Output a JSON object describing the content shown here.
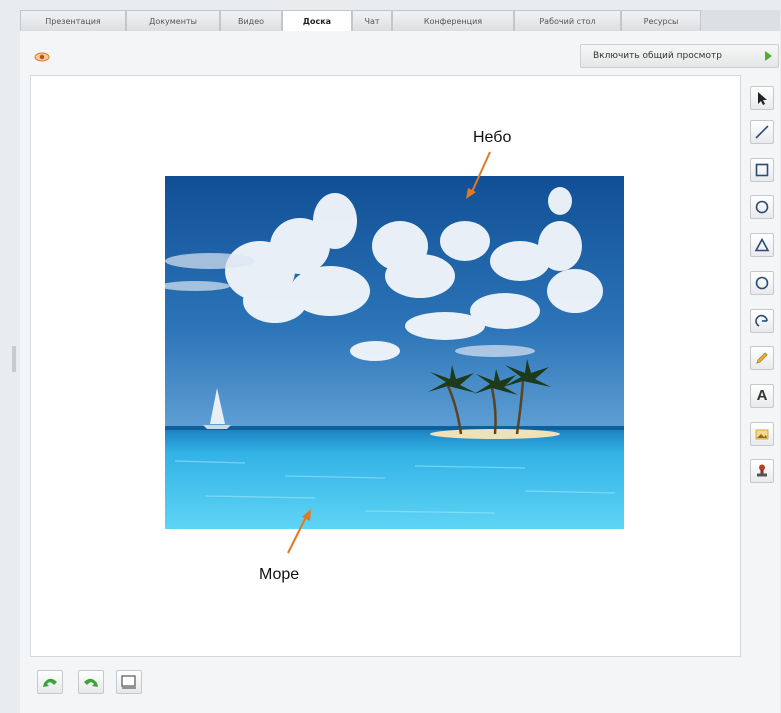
{
  "tabs": [
    {
      "label": "Презентация",
      "active": false
    },
    {
      "label": "Документы",
      "active": false
    },
    {
      "label": "Видео",
      "active": false
    },
    {
      "label": "Доска",
      "active": true
    },
    {
      "label": "Чат",
      "active": false
    },
    {
      "label": "Конференция",
      "active": false
    },
    {
      "label": "Рабочий стол",
      "active": false
    },
    {
      "label": "Ресурсы",
      "active": false
    }
  ],
  "header": {
    "share_label": "Включить общий просмотр"
  },
  "board": {
    "annotations": {
      "sky": "Небо",
      "sea": "Море"
    },
    "arrow_color": "#e07a1f"
  },
  "toolbar": {
    "tools": [
      "select-icon",
      "line-icon",
      "rectangle-icon",
      "ellipse-icon",
      "triangle-icon",
      "circle-icon",
      "rotate-icon",
      "pencil-icon",
      "text-icon",
      "insert-image-icon",
      "stamp-icon"
    ],
    "text_tool_glyph": "A"
  },
  "footer": {
    "buttons": [
      "undo-icon",
      "redo-icon",
      "clear-board-icon"
    ]
  }
}
